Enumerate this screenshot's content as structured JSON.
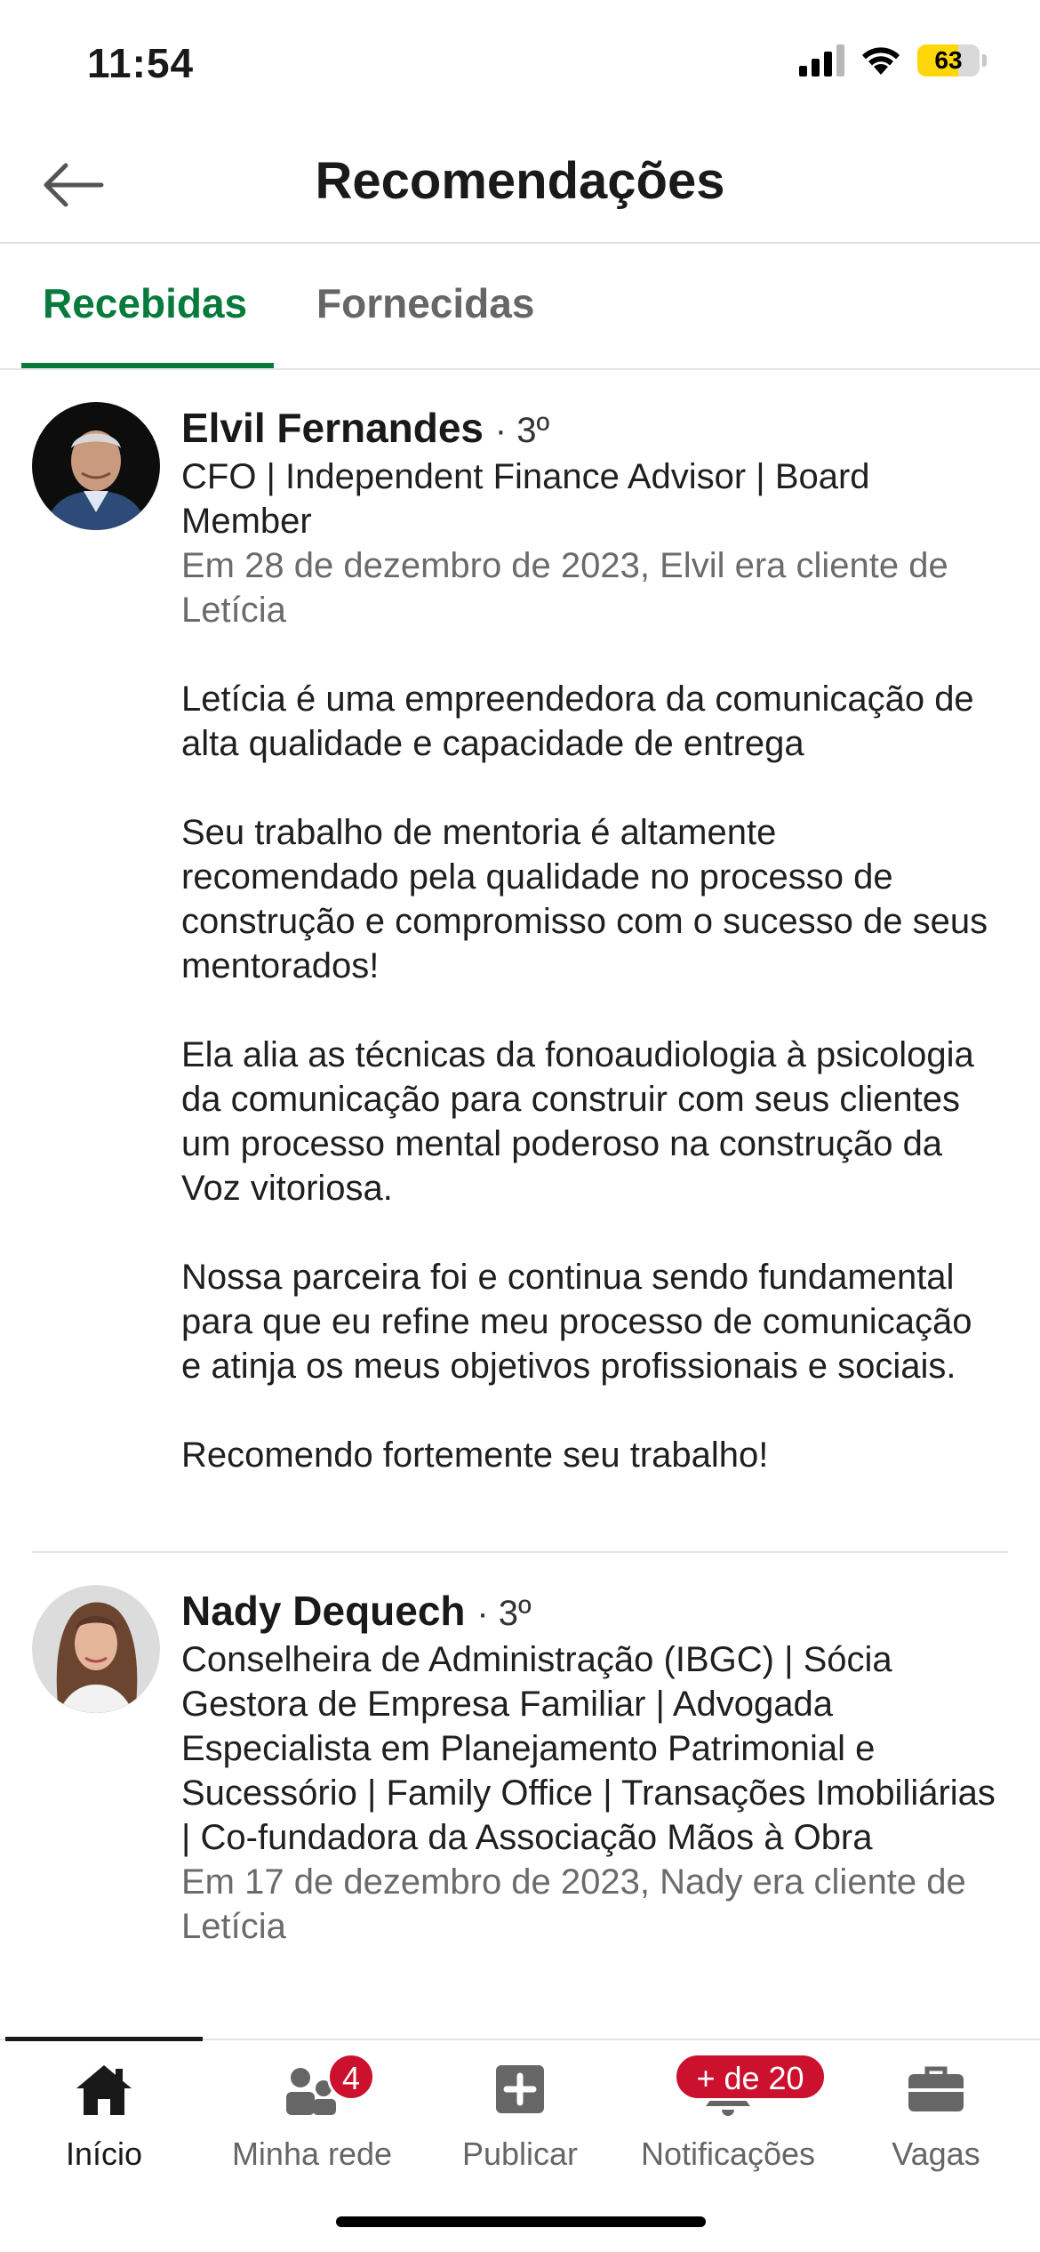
{
  "status_bar": {
    "time": "11:54",
    "battery": "63"
  },
  "header": {
    "title": "Recomendações"
  },
  "tabs": [
    {
      "label": "Recebidas",
      "active": true
    },
    {
      "label": "Fornecidas",
      "active": false
    }
  ],
  "recommendations": [
    {
      "name": "Elvil Fernandes",
      "degree": "· 3º",
      "headline": "CFO  | Independent Finance Advisor | Board Member",
      "relation": "Em 28 de dezembro de 2023, Elvil era cliente de Letícia",
      "paragraphs": [
        "Letícia é uma empreendedora da comunicação de alta qualidade e capacidade de entrega",
        "Seu trabalho de mentoria é altamente recomendado pela qualidade no processo de construção e compromisso com o sucesso de seus mentorados!",
        "Ela alia as técnicas da fonoaudiologia à psicologia da comunicação para construir com seus clientes um processo mental poderoso na construção da Voz vitoriosa.",
        "Nossa parceira foi e continua sendo fundamental para que eu refine meu processo de comunicação e atinja os meus objetivos profissionais e sociais.",
        "Recomendo fortemente seu trabalho!"
      ]
    },
    {
      "name": "Nady Dequech",
      "degree": "· 3º",
      "headline": "Conselheira de Administração (IBGC) | Sócia Gestora de Empresa Familiar | Advogada Especialista em Planejamento Patrimonial e Sucessório | Family Office | Transações Imobiliárias | Co-fundadora da Associação Mãos à Obra",
      "relation": "Em 17 de dezembro de 2023, Nady era cliente de Letícia"
    }
  ],
  "bottom_nav": [
    {
      "label": "Início",
      "icon": "home-icon",
      "active": true
    },
    {
      "label": "Minha rede",
      "icon": "network-icon",
      "badge": "4"
    },
    {
      "label": "Publicar",
      "icon": "plus-square-icon"
    },
    {
      "label": "Notificações",
      "icon": "bell-icon",
      "badge": "+ de 20"
    },
    {
      "label": "Vagas",
      "icon": "briefcase-icon"
    }
  ],
  "colors": {
    "accent": "#087a3c",
    "badge": "#cb112d",
    "battery": "#ffd60a"
  }
}
